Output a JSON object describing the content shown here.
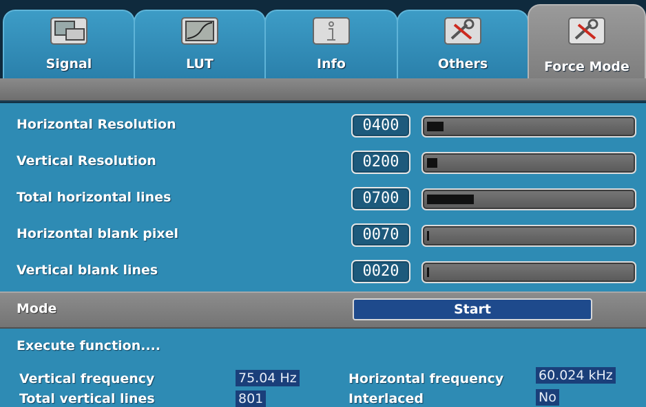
{
  "tabs": [
    {
      "label": "Signal",
      "icon": "monitor-icon",
      "active": false
    },
    {
      "label": "LUT",
      "icon": "curve-icon",
      "active": false
    },
    {
      "label": "Info",
      "icon": "info-icon",
      "active": false
    },
    {
      "label": "Others",
      "icon": "tools-icon",
      "active": false
    },
    {
      "label": "Force Mode",
      "icon": "tools-icon",
      "active": true
    }
  ],
  "settings": [
    {
      "label": "Horizontal Resolution",
      "value": "0400",
      "level": 0.08
    },
    {
      "label": "Vertical Resolution",
      "value": "0200",
      "level": 0.05
    },
    {
      "label": "Total horizontal lines",
      "value": "0700",
      "level": 0.23
    },
    {
      "label": "Horizontal blank pixel",
      "value": "0070",
      "level": 0.01
    },
    {
      "label": "Vertical blank lines",
      "value": "0020",
      "level": 0.0
    }
  ],
  "mode": {
    "label": "Mode",
    "button_label": "Start"
  },
  "execute_label": "Execute function....",
  "info": {
    "vertical_frequency_label": "Vertical frequency",
    "vertical_frequency_value": "75.04 Hz",
    "horizontal_frequency_label": "Horizontal frequency",
    "horizontal_frequency_value": "60.024 kHz",
    "total_vertical_lines_label": "Total vertical lines",
    "total_vertical_lines_value": "801",
    "interlaced_label": "Interlaced",
    "interlaced_value": "No"
  },
  "colors": {
    "background": "#2e8bb4",
    "tab_active": "#8a8a8a",
    "start_button": "#1e4a8c",
    "info_value_bg": "#1a3f7a"
  }
}
